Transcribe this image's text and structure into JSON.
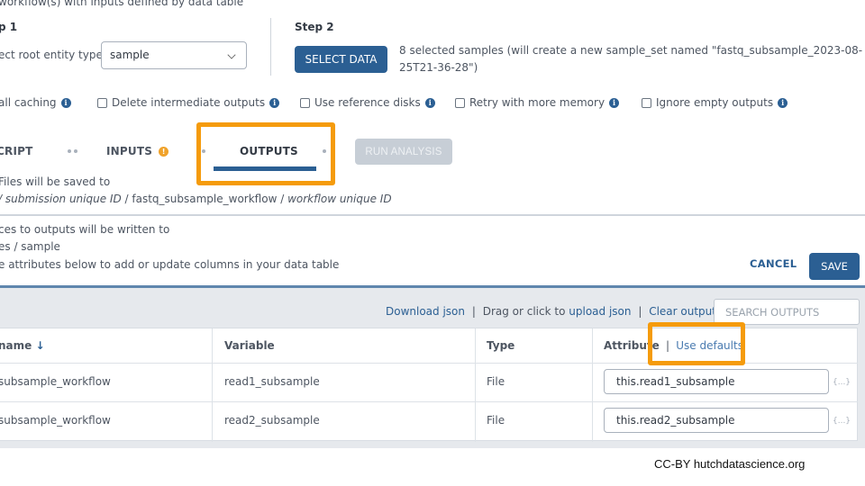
{
  "header": {
    "subtitle": "workflow(s) with inputs defined by data table"
  },
  "step1": {
    "title": "p 1",
    "label": "ect root entity type:",
    "select_value": "sample"
  },
  "step2": {
    "title": "Step 2",
    "select_data_label": "SELECT DATA",
    "selection_text_line1": "8 selected samples (will create a new sample_set named \"fastq_subsample_2023-08-",
    "selection_text_line2": "25T21-36-28\")"
  },
  "options": [
    {
      "label": "all caching",
      "checkbox": false
    },
    {
      "label": "Delete intermediate outputs",
      "checkbox": true,
      "checked": false
    },
    {
      "label": "Use reference disks",
      "checkbox": true,
      "checked": false
    },
    {
      "label": "Retry with more memory",
      "checkbox": true,
      "checked": false
    },
    {
      "label": "Ignore empty outputs",
      "checkbox": true,
      "checked": false
    }
  ],
  "tabs": [
    {
      "label": "CRIPT"
    },
    {
      "label": "INPUTS",
      "warning": true
    },
    {
      "label": "OUTPUTS",
      "active": true
    }
  ],
  "run_analysis_label": "RUN ANALYSIS",
  "output_info": {
    "files_saved_label": "Files will be saved to",
    "files_saved_path": {
      "part1": "/ submission unique ID",
      "part2": " / fastq_subsample_workflow / ",
      "part3": "workflow unique ID"
    },
    "references_label": "ces to outputs will be written to",
    "references_path": "es / sample",
    "attributes_hint": "e attributes below to add or update columns in your data table"
  },
  "actions": {
    "cancel_label": "CANCEL",
    "save_label": "SAVE"
  },
  "toolbar": {
    "download_json": "Download json",
    "sep1": "|",
    "drag_text": "Drag or click to",
    "upload_json": "upload json",
    "sep2": "|",
    "clear_outputs": "Clear outputs",
    "search_placeholder": "SEARCH OUTPUTS"
  },
  "table": {
    "headers": {
      "name": "name",
      "sort_icon": "↓",
      "variable": "Variable",
      "type": "Type",
      "attribute": "Attribute",
      "attribute_sep": "|",
      "use_defaults": "Use defaults"
    },
    "rows": [
      {
        "name": "subsample_workflow",
        "variable": "read1_subsample",
        "type": "File",
        "attribute": "this.read1_subsample",
        "brace": "{...}"
      },
      {
        "name": "subsample_workflow",
        "variable": "read2_subsample",
        "type": "File",
        "attribute": "this.read2_subsample",
        "brace": "{...}"
      }
    ]
  },
  "footer": {
    "credit": "CC-BY  hutchdatascience.org"
  },
  "colors": {
    "primary": "#2b5f93",
    "highlight": "#f59b0c",
    "warning": "#f0a22a",
    "disabled": "#c7ced6"
  }
}
